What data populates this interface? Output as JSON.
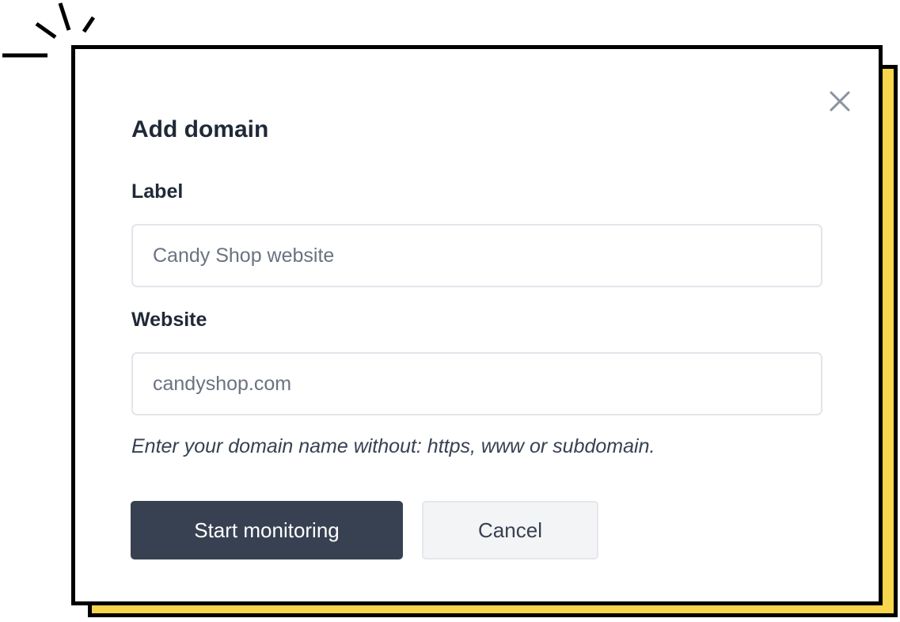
{
  "dialog": {
    "title": "Add domain",
    "close_icon": "close-icon",
    "fields": [
      {
        "label": "Label",
        "placeholder": "Candy Shop website",
        "value": ""
      },
      {
        "label": "Website",
        "placeholder": "candyshop.com",
        "value": ""
      }
    ],
    "hint": "Enter your domain name without: https, www or subdomain.",
    "primary_button": "Start monitoring",
    "secondary_button": "Cancel"
  },
  "colors": {
    "accent_shadow": "#f7d54c",
    "primary_button_bg": "#374151",
    "border": "#000000"
  }
}
